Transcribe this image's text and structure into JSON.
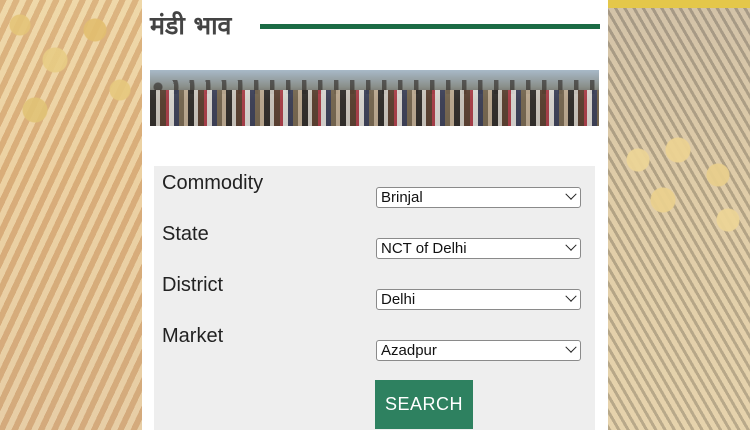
{
  "header": {
    "title": "मंडी भाव"
  },
  "form": {
    "fields": [
      {
        "label": "Commodity",
        "value": "Brinjal"
      },
      {
        "label": "State",
        "value": "NCT of Delhi"
      },
      {
        "label": "District",
        "value": "Delhi"
      },
      {
        "label": "Market",
        "value": "Azadpur"
      }
    ],
    "search_label": "SEARCH"
  },
  "icons": {
    "dropdown": "chevron-down-icon"
  },
  "colors": {
    "accent_green": "#1b6b45",
    "button_green": "#2e8160",
    "panel_bg": "#eeeeee"
  }
}
